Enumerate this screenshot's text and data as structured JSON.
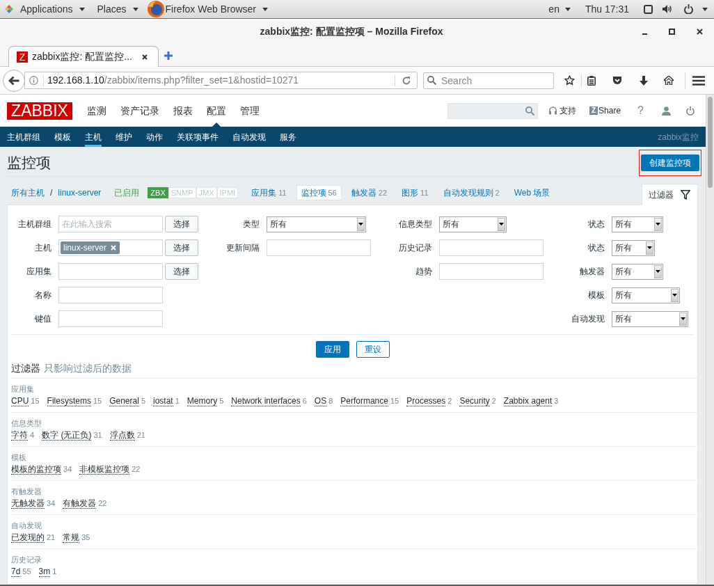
{
  "desktop_bar": {
    "menus": [
      {
        "label": "Applications",
        "kind": "applications"
      },
      {
        "label": "Places",
        "kind": "places"
      },
      {
        "label": "Firefox Web Browser",
        "kind": "window"
      }
    ],
    "keyboard": "en",
    "clock": "Thu 17:31"
  },
  "window": {
    "title": "zabbix监控: 配置监控项 – Mozilla Firefox"
  },
  "browser": {
    "tabs": [
      {
        "favicon": "Z",
        "title": "zabbix监控: 配置监控...",
        "selected": true
      }
    ],
    "url": {
      "host": "192.168.1.10",
      "path": "/zabbix/items.php?filter_set=1&hostid=10271"
    },
    "search": {
      "placeholder": "Search"
    }
  },
  "header": {
    "logo": "ZABBIX",
    "menu": [
      {
        "label": "监测",
        "selected": false
      },
      {
        "label": "资产记录",
        "selected": false
      },
      {
        "label": "报表",
        "selected": false
      },
      {
        "label": "配置",
        "selected": true
      },
      {
        "label": "管理",
        "selected": false
      }
    ],
    "support": "支持",
    "share": {
      "badge": "Z",
      "label": "Share"
    },
    "help": "?"
  },
  "sub_menu": {
    "items": [
      {
        "label": "主机群组",
        "selected": false
      },
      {
        "label": "模板",
        "selected": false
      },
      {
        "label": "主机",
        "selected": true
      },
      {
        "label": "维护",
        "selected": false
      },
      {
        "label": "动作",
        "selected": false
      },
      {
        "label": "关联项事件",
        "selected": false
      },
      {
        "label": "自动发现",
        "selected": false
      },
      {
        "label": "服务",
        "selected": false
      }
    ],
    "server_name": "zabbix监控"
  },
  "page": {
    "title": "监控项",
    "create_button": "创建监控项"
  },
  "host_nav": {
    "breadcrumb": [
      {
        "label": "所有主机"
      },
      {
        "label": "linux-server"
      }
    ],
    "separator": "/",
    "status": "已启用",
    "interfaces": [
      {
        "label": "ZBX",
        "available": true
      },
      {
        "label": "SNMP",
        "available": false
      },
      {
        "label": "JMX",
        "available": false
      },
      {
        "label": "IPMI",
        "available": false
      }
    ],
    "tabs": [
      {
        "label": "应用集",
        "count": "11",
        "selected": false
      },
      {
        "label": "监控项",
        "count": "56",
        "selected": true
      },
      {
        "label": "触发器",
        "count": "22",
        "selected": false
      },
      {
        "label": "图形",
        "count": "11",
        "selected": false
      },
      {
        "label": "自动发现规则",
        "count": "2",
        "selected": false
      },
      {
        "label": "Web 场景",
        "selected": false
      }
    ]
  },
  "filter": {
    "tab_label": "过滤器",
    "columns": [
      [
        {
          "label": "主机群组",
          "kind": "multiselect",
          "placeholder": "在此输入搜索",
          "button": "选择"
        },
        {
          "label": "主机",
          "kind": "multiselect",
          "chips": [
            {
              "label": "linux-server"
            }
          ],
          "button": "选择"
        },
        {
          "label": "应用集",
          "kind": "text",
          "button": "选择"
        },
        {
          "label": "名称",
          "kind": "text"
        },
        {
          "label": "键值",
          "kind": "text"
        }
      ],
      [
        {
          "label": "类型",
          "kind": "select",
          "value": "所有"
        },
        {
          "label": "更新间隔",
          "kind": "text"
        }
      ],
      [
        {
          "label": "信息类型",
          "kind": "select",
          "value": "所有"
        },
        {
          "label": "历史记录",
          "kind": "text"
        },
        {
          "label": "趋势",
          "kind": "text"
        }
      ],
      [
        {
          "label": "状态",
          "kind": "select",
          "value": "所有"
        },
        {
          "label": "状态",
          "kind": "select",
          "value": "所有"
        },
        {
          "label": "触发器",
          "kind": "select",
          "value": "所有"
        },
        {
          "label": "模板",
          "kind": "select",
          "value": "所有"
        },
        {
          "label": "自动发现",
          "kind": "select",
          "value": "所有"
        }
      ]
    ],
    "apply_button": "应用",
    "reset_button": "重设"
  },
  "subfilter": {
    "title": "过滤器",
    "note": "只影响过滤后的数据",
    "groups": [
      {
        "label": "应用集",
        "items": [
          {
            "name": "CPU",
            "count": "15"
          },
          {
            "name": "Filesystems",
            "count": "15"
          },
          {
            "name": "General",
            "count": "5"
          },
          {
            "name": "iostat",
            "count": "1"
          },
          {
            "name": "Memory",
            "count": "5"
          },
          {
            "name": "Network interfaces",
            "count": "6"
          },
          {
            "name": "OS",
            "count": "8"
          },
          {
            "name": "Performance",
            "count": "15"
          },
          {
            "name": "Processes",
            "count": "2"
          },
          {
            "name": "Security",
            "count": "2"
          },
          {
            "name": "Zabbix agent",
            "count": "3"
          }
        ]
      },
      {
        "label": "信息类型",
        "items": [
          {
            "name": "字符",
            "count": "4"
          },
          {
            "name": "数字 (无正负)",
            "count": "31"
          },
          {
            "name": "浮点数",
            "count": "21"
          }
        ]
      },
      {
        "label": "模板",
        "items": [
          {
            "name": "模板的监控项",
            "count": "34"
          },
          {
            "name": "非模板监控项",
            "count": "22"
          }
        ]
      },
      {
        "label": "有触发器",
        "items": [
          {
            "name": "无触发器",
            "count": "34"
          },
          {
            "name": "有触发器",
            "count": "22"
          }
        ]
      },
      {
        "label": "自动发现",
        "items": [
          {
            "name": "已发现的",
            "count": "21"
          },
          {
            "name": "常规",
            "count": "35"
          }
        ]
      },
      {
        "label": "历史记录",
        "items": [
          {
            "name": "7d",
            "count": "55"
          },
          {
            "name": "3m",
            "count": "1"
          }
        ]
      }
    ]
  }
}
